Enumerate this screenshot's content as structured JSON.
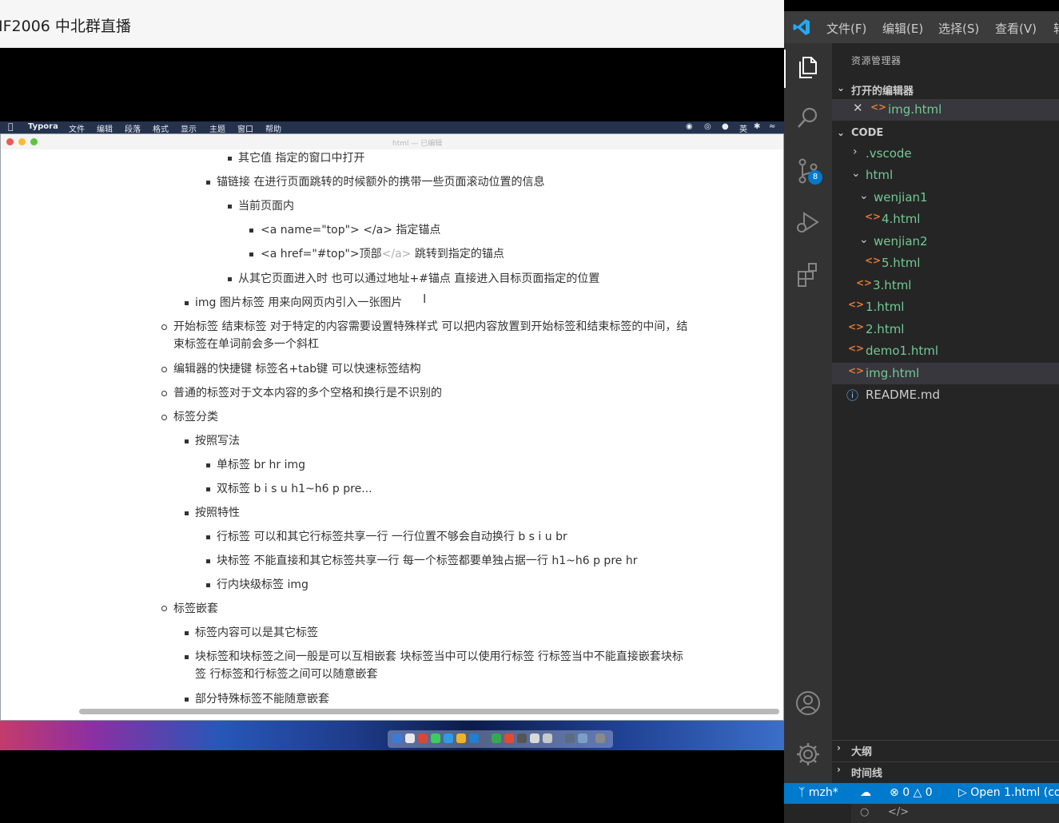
{
  "stream": {
    "title": "IF2006 中北群直播"
  },
  "mac_menubar": {
    "app": "Typora",
    "menus": [
      "文件",
      "编辑",
      "段落",
      "格式",
      "显示",
      "主题",
      "窗口",
      "帮助"
    ],
    "input_method": "英"
  },
  "typora": {
    "window_title": "html — 已编辑",
    "lines": [
      "其它值 指定的窗口中打开",
      "锚链接 在进行页面跳转的时候额外的携带一些页面滚动位置的信息",
      "当前页面内",
      "<a name=\"top\"> </a> 指定锚点",
      "<a href=\"#top\">顶部",
      "</a>",
      "跳转到指定的锚点",
      "从其它页面进入时 也可以通过地址+#锚点 直接进入目标页面指定的位置",
      "img 图片标签 用来向网页内引入一张图片",
      "开始标签 结束标签  对于特定的内容需要设置特殊样式 可以把内容放置到开始标签和结束标签的中间，结",
      "束标签在单词前会多一个斜杠",
      "编辑器的快捷键  标签名+tab键 可以快速标签结构",
      "普通的标签对于文本内容的多个空格和换行是不识别的",
      "标签分类",
      "按照写法",
      "单标签  br hr img",
      "双标签  b i s u h1~h6 p pre...",
      "按照特性",
      "行标签 可以和其它行标签共享一行 一行位置不够会自动换行 b s i u br",
      "块标签 不能直接和其它标签共享一行 每一个标签都要单独占据一行 h1~h6 p pre hr",
      "行内块级标签  img",
      "标签嵌套",
      "标签内容可以是其它标签",
      "块标签和块标签之间一般是可以互相嵌套 块标签当中可以使用行标签  行标签当中不能直接嵌套块标",
      "签 行标签和行标签之间可以随意嵌套",
      "部分特殊标签不能随意嵌套"
    ]
  },
  "vscode": {
    "menus": [
      "文件(F)",
      "编辑(E)",
      "选择(S)",
      "查看(V)",
      "转"
    ],
    "scm_badge": "8",
    "explorer_title": "资源管理器",
    "open_editors_label": "打开的编辑器",
    "open_editor_file": "img.html",
    "workspace_label": "CODE",
    "tree": [
      {
        "label": ".vscode"
      },
      {
        "label": "html"
      },
      {
        "label": "wenjian1"
      },
      {
        "label": "4.html"
      },
      {
        "label": "wenjian2"
      },
      {
        "label": "5.html"
      },
      {
        "label": "3.html"
      },
      {
        "label": "1.html"
      },
      {
        "label": "2.html"
      },
      {
        "label": "demo1.html"
      },
      {
        "label": "img.html"
      },
      {
        "label": "README.md"
      }
    ],
    "outline_label": "大纲",
    "timeline_label": "时间线",
    "status": {
      "branch": "mzh*",
      "errors": "0",
      "warnings": "0",
      "open_action": "Open 1.html (co"
    },
    "colors": {
      "accent": "#007acc",
      "git_added": "#73c991",
      "html_icon": "#e37933"
    }
  }
}
